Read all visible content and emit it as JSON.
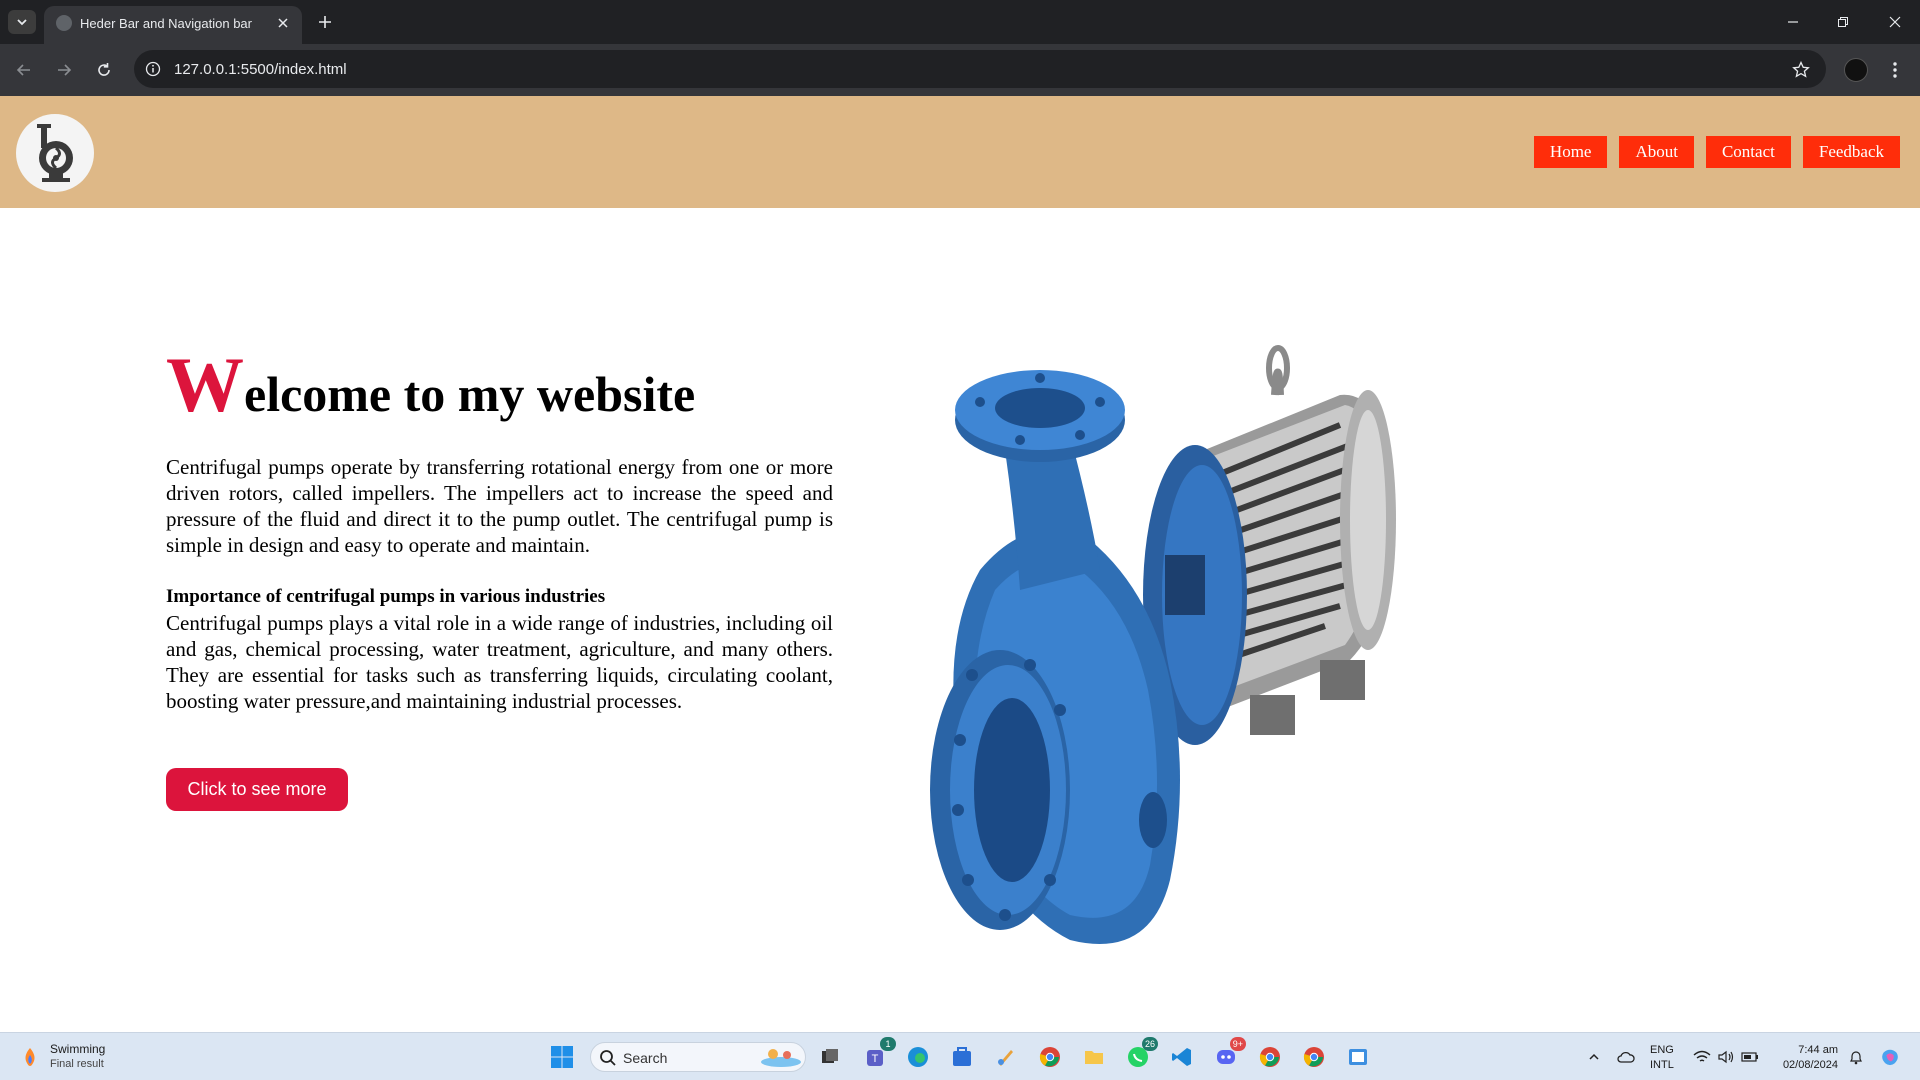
{
  "browser": {
    "tab_title": "Heder Bar and Navigation bar",
    "url": "127.0.0.1:5500/index.html"
  },
  "header": {
    "nav": [
      {
        "label": "Home"
      },
      {
        "label": "About"
      },
      {
        "label": "Contact"
      },
      {
        "label": "Feedback"
      }
    ]
  },
  "main": {
    "title_initial": "W",
    "title_rest": "elcome to my website",
    "paragraph1": "Centrifugal pumps operate by transferring rotational energy from one or more driven rotors, called impellers. The impellers act to increase the speed and pressure of the fluid and direct it to the pump outlet. The centrifugal pump is simple in design and easy to operate and maintain.",
    "subheading": "Importance of centrifugal pumps in various industries",
    "paragraph2": "Centrifugal pumps plays a vital role in a wide range of industries, including oil and gas, chemical processing, water treatment, agriculture, and many others. They are essential for tasks such as transferring liquids, circulating coolant, boosting water pressure,and maintaining industrial processes.",
    "cta_label": "Click to see more"
  },
  "taskbar": {
    "weather_title": "Swimming",
    "weather_subtitle": "Final result",
    "search_label": "Search",
    "badges": {
      "teams": "1",
      "whatsapp": "26",
      "discord": "9+"
    },
    "language_line1": "ENG",
    "language_line2": "INTL",
    "time": "7:44 am",
    "date": "02/08/2024"
  },
  "colors": {
    "header_bg": "#deb887",
    "nav_button": "#ff2d0a",
    "accent_crimson": "#dc143c",
    "pump_blue": "#2f6fb5"
  }
}
